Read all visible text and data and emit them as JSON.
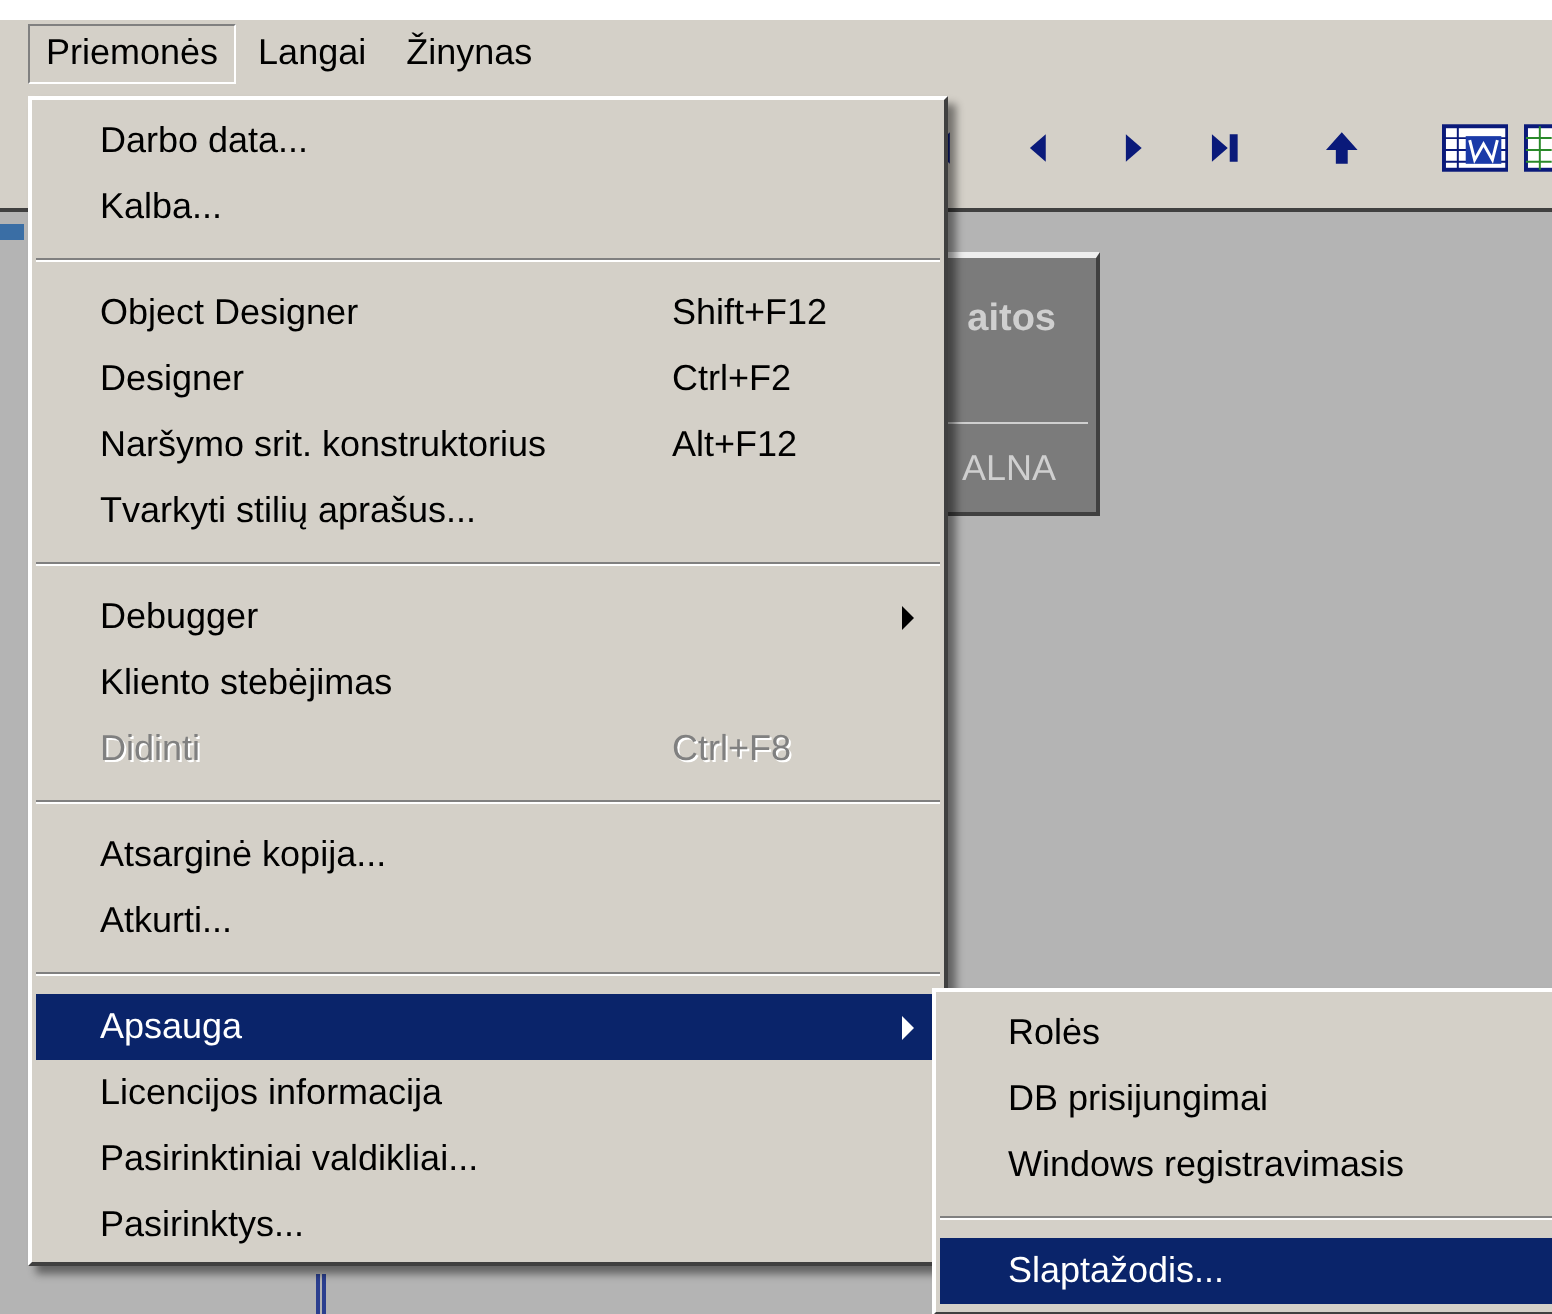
{
  "menubar": [
    {
      "label": "Priemonės",
      "selected": true
    },
    {
      "label": "Langai",
      "selected": false
    },
    {
      "label": "Žinynas",
      "selected": false
    }
  ],
  "background_panel": {
    "title": "aitos",
    "footer": "ALNA"
  },
  "menu": [
    {
      "kind": "item",
      "label": "Darbo data...",
      "disabled": false,
      "selected": false,
      "submenu": false
    },
    {
      "kind": "item",
      "label": "Kalba...",
      "disabled": false,
      "selected": false,
      "submenu": false
    },
    {
      "kind": "separator"
    },
    {
      "kind": "item",
      "label": "Object Designer",
      "shortcut": "Shift+F12",
      "disabled": false,
      "selected": false,
      "submenu": false
    },
    {
      "kind": "item",
      "label": "Designer",
      "shortcut": "Ctrl+F2",
      "disabled": false,
      "selected": false,
      "submenu": false
    },
    {
      "kind": "item",
      "label": "Naršymo srit. konstruktorius",
      "shortcut": "Alt+F12",
      "disabled": false,
      "selected": false,
      "submenu": false
    },
    {
      "kind": "item",
      "label": "Tvarkyti stilių aprašus...",
      "disabled": false,
      "selected": false,
      "submenu": false
    },
    {
      "kind": "separator"
    },
    {
      "kind": "item",
      "label": "Debugger",
      "disabled": false,
      "selected": false,
      "submenu": true
    },
    {
      "kind": "item",
      "label": "Kliento stebėjimas",
      "disabled": false,
      "selected": false,
      "submenu": false
    },
    {
      "kind": "item",
      "label": "Didinti",
      "shortcut": "Ctrl+F8",
      "disabled": true,
      "selected": false,
      "submenu": false
    },
    {
      "kind": "separator"
    },
    {
      "kind": "item",
      "label": "Atsarginė kopija...",
      "disabled": false,
      "selected": false,
      "submenu": false
    },
    {
      "kind": "item",
      "label": "Atkurti...",
      "disabled": false,
      "selected": false,
      "submenu": false
    },
    {
      "kind": "separator"
    },
    {
      "kind": "item",
      "label": "Apsauga",
      "disabled": false,
      "selected": true,
      "submenu": true
    },
    {
      "kind": "item",
      "label": "Licencijos informacija",
      "disabled": false,
      "selected": false,
      "submenu": false
    },
    {
      "kind": "item",
      "label": "Pasirinktiniai valdikliai...",
      "disabled": false,
      "selected": false,
      "submenu": false
    },
    {
      "kind": "item",
      "label": "Pasirinktys...",
      "disabled": false,
      "selected": false,
      "submenu": false
    }
  ],
  "submenu": [
    {
      "kind": "item",
      "label": "Rolės",
      "selected": false
    },
    {
      "kind": "item",
      "label": "DB prisijungimai",
      "selected": false
    },
    {
      "kind": "item",
      "label": "Windows registravimasis",
      "selected": false
    },
    {
      "kind": "separator"
    },
    {
      "kind": "item",
      "label": "Slaptažodis...",
      "selected": true
    }
  ]
}
